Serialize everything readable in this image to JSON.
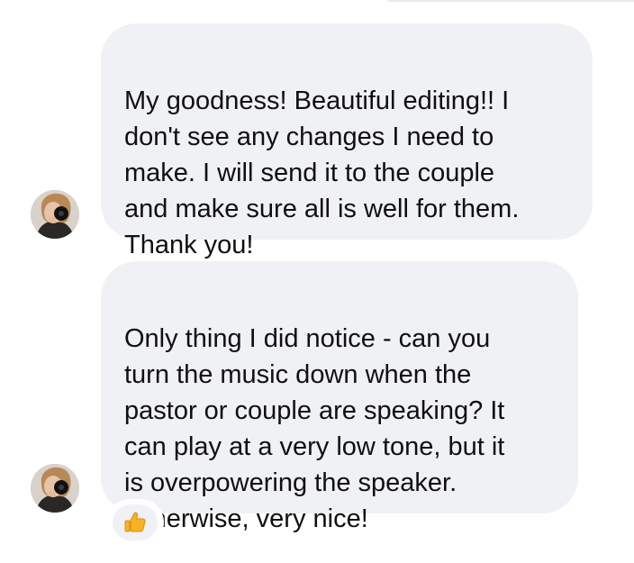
{
  "messages": [
    {
      "text": "My goodness! Beautiful editing!! I\ndon't see any changes I need to\nmake. I will send it to the couple\nand make sure all is well for them.\nThank you!"
    },
    {
      "text": "Only thing I did notice - can you\nturn the music down when the\npastor or couple are speaking? It\ncan play at a very low tone, but it\nis overpowering the speaker.\nOtherwise, very nice!",
      "reaction": "thumbs-up-icon"
    }
  ],
  "colors": {
    "bubble_background": "#f0f1f4",
    "text": "#101010",
    "reaction_thumb": "#f5b324"
  }
}
